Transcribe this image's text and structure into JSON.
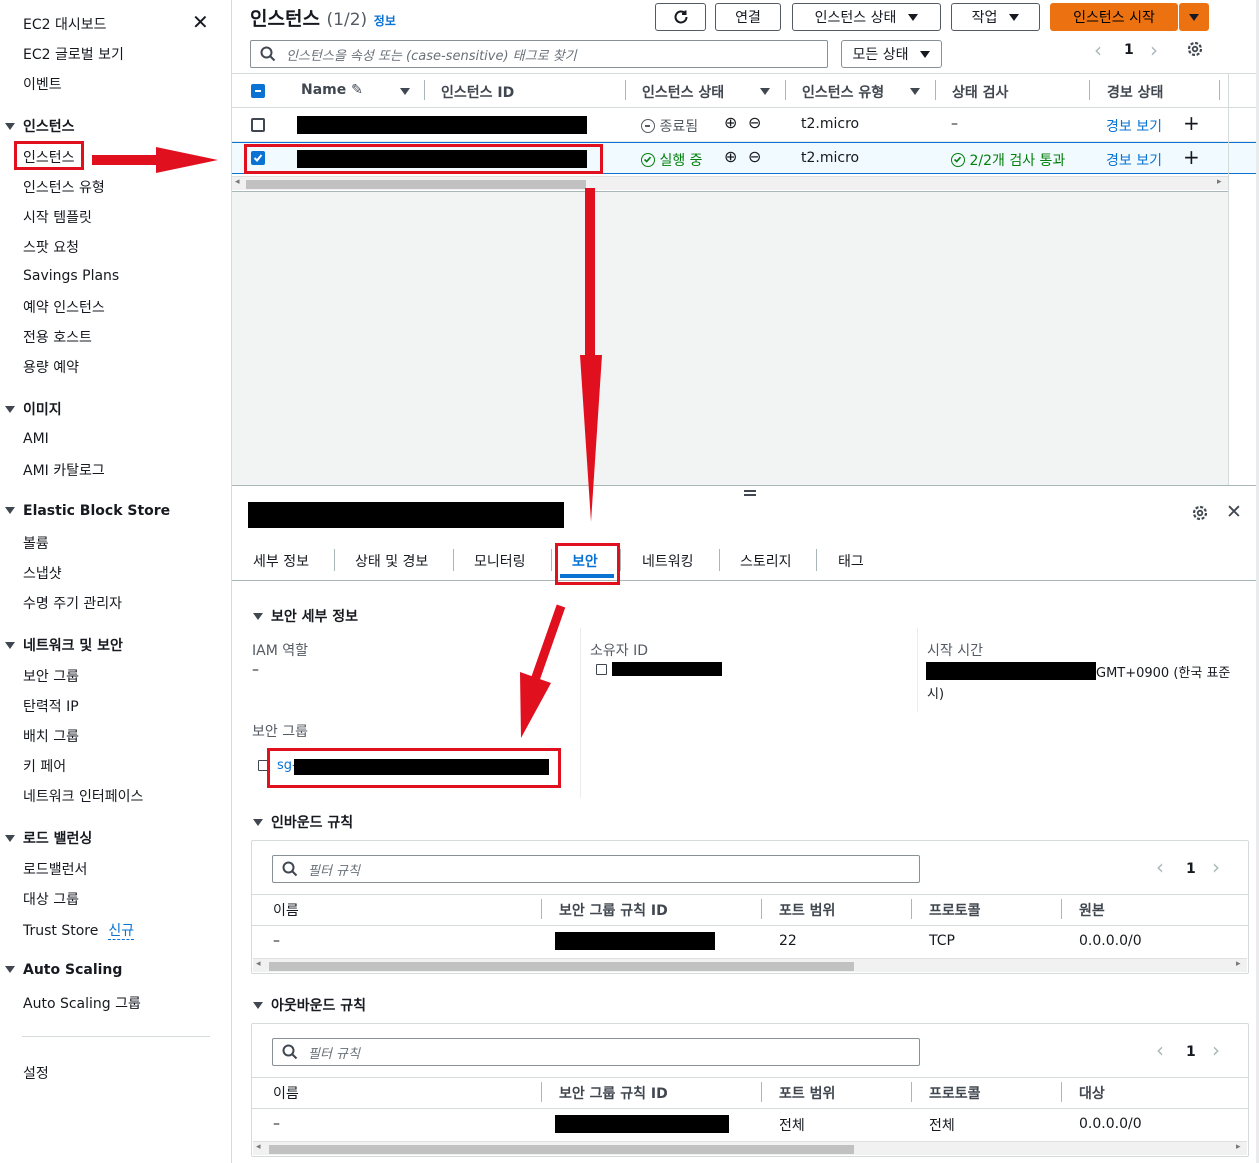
{
  "sidebar": {
    "top_items": [
      "EC2 대시보드",
      "EC2 글로벌 보기",
      "이벤트"
    ],
    "sections": [
      {
        "title": "인스턴스",
        "items": [
          "인스턴스",
          "인스턴스 유형",
          "시작 템플릿",
          "스팟 요청",
          "Savings Plans",
          "예약 인스턴스",
          "전용 호스트",
          "용량 예약"
        ]
      },
      {
        "title": "이미지",
        "items": [
          "AMI",
          "AMI 카탈로그"
        ]
      },
      {
        "title": "Elastic Block Store",
        "items": [
          "볼륨",
          "스냅샷",
          "수명 주기 관리자"
        ]
      },
      {
        "title": "네트워크 및 보안",
        "items": [
          "보안 그룹",
          "탄력적 IP",
          "배치 그룹",
          "키 페어",
          "네트워크 인터페이스"
        ]
      },
      {
        "title": "로드 밸런싱",
        "items": [
          "로드밸런서",
          "대상 그룹",
          "Trust Store"
        ]
      },
      {
        "title": "Auto Scaling",
        "items": [
          "Auto Scaling 그룹"
        ]
      }
    ],
    "trust_store_badge": "신규",
    "settings": "설정",
    "close_glyph": "✕"
  },
  "header": {
    "title": "인스턴스",
    "count": "(1/2)",
    "info": "정보",
    "connect": "연결",
    "instance_state": "인스턴스 상태",
    "actions": "작업",
    "launch": "인스턴스 시작",
    "search_placeholder": "인스턴스을 속성 또는 (case-sensitive) 태그로 찾기",
    "state_filter": "모든 상태",
    "page": "1"
  },
  "table": {
    "columns": [
      "Name",
      "인스턴스 ID",
      "인스턴스 상태",
      "인스턴스 유형",
      "상태 검사",
      "경보 상태"
    ],
    "rows": [
      {
        "state": "종료됨",
        "type": "t2.micro",
        "check": "–",
        "alarm": "경보 보기",
        "checked": false
      },
      {
        "state": "실행 중",
        "type": "t2.micro",
        "check": "2/2개 검사 통과",
        "alarm": "경보 보기",
        "checked": true
      }
    ]
  },
  "detail": {
    "tabs": [
      "세부 정보",
      "상태 및 경보",
      "모니터링",
      "보안",
      "네트워킹",
      "스토리지",
      "태그"
    ],
    "active_tab": "보안",
    "security_section": "보안 세부 정보",
    "iam_label": "IAM 역할",
    "iam_value": "–",
    "owner_label": "소유자 ID",
    "launch_label": "시작 시간",
    "launch_value_tail": "GMT+0900 (한국 표준",
    "launch_value_tail2": "시)",
    "sg_label": "보안 그룹",
    "sg_prefix": "sg-"
  },
  "inbound": {
    "title": "인바운드 규칙",
    "placeholder": "필터 규칙",
    "page": "1",
    "columns": [
      "이름",
      "보안 그룹 규칙 ID",
      "포트 범위",
      "프로토콜",
      "원본"
    ],
    "row": {
      "name": "–",
      "port": "22",
      "protocol": "TCP",
      "source": "0.0.0.0/0"
    }
  },
  "outbound": {
    "title": "아웃바운드 규칙",
    "placeholder": "필터 규칙",
    "page": "1",
    "columns": [
      "이름",
      "보안 그룹 규칙 ID",
      "포트 범위",
      "프로토콜",
      "대상"
    ],
    "row": {
      "name": "–",
      "port": "전체",
      "protocol": "전체",
      "dest": "0.0.0.0/0"
    }
  },
  "colors": {
    "accent": "#ec7211",
    "link": "#0972d3",
    "success": "#037f0c",
    "annotation": "#e0101f"
  }
}
